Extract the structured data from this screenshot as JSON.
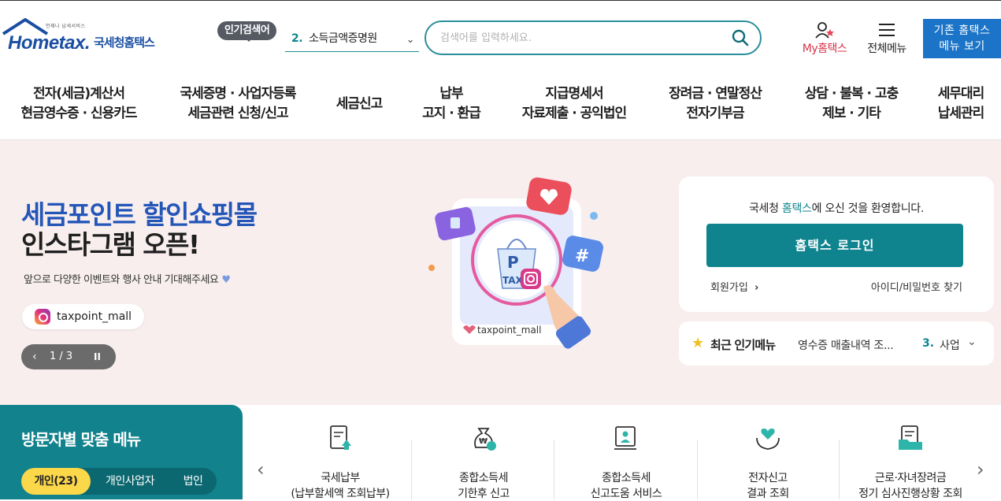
{
  "header": {
    "logo_tiny": "언제나 납세서비스",
    "logo_brand": "Hometax.",
    "logo_ko": "국세청홈택스",
    "popular_badge": "인기검색어",
    "popular_num": "2.",
    "popular_term": "소득금액증명원",
    "search_placeholder": "검색어를 입력하세요.",
    "my_hometax": "My홈택스",
    "all_menu": "전체메뉴",
    "old_hometax_1": "기존 홈택스",
    "old_hometax_2": "메뉴 보기"
  },
  "gnb": [
    {
      "l1": "전자(세금)계산서",
      "l2": "현금영수증 · 신용카드"
    },
    {
      "l1": "국세증명 · 사업자등록",
      "l2": "세금관련 신청/신고"
    },
    {
      "l1": "세금신고",
      "l2": ""
    },
    {
      "l1": "납부",
      "l2": "고지 · 환급"
    },
    {
      "l1": "지급명세서",
      "l2": "자료제출 · 공익법인"
    },
    {
      "l1": "장려금 · 연말정산",
      "l2": "전자기부금"
    },
    {
      "l1": "상담 · 불복 · 고충",
      "l2": "제보 · 기타"
    },
    {
      "l1": "세무대리",
      "l2": "납세관리"
    }
  ],
  "banner": {
    "title1": "세금포인트 할인쇼핑몰",
    "title2": "인스타그램 오픈!",
    "subtitle": "앞으로 다양한 이벤트와 행사 안내 기대해주세요",
    "tag": "taxpoint_mall",
    "pager": "1 / 3",
    "card_tag": "taxpoint_mall",
    "bag_letter": "P",
    "bag_text": "TAX"
  },
  "login": {
    "welcome_pre": "국세청 ",
    "welcome_hl": "홈택스",
    "welcome_post": "에 오신 것을 환영합니다.",
    "login_button": "홈택스 로그인",
    "signup": "회원가입",
    "find": "아이디/비밀번호 찾기"
  },
  "recent": {
    "title": "최근 인기메뉴",
    "item": "영수증 매출내역 조...",
    "num": "3.",
    "category": "사업"
  },
  "visitor": {
    "title": "방문자별 맞춤 메뉴",
    "tabs": [
      "개인(23)",
      "개인사업자",
      "법인"
    ]
  },
  "quick_menu": [
    {
      "l1": "국세납부",
      "l2": "(납부할세액 조회납부)"
    },
    {
      "l1": "종합소득세",
      "l2": "기한후 신고"
    },
    {
      "l1": "종합소득세",
      "l2": "신고도움 서비스"
    },
    {
      "l1": "전자신고",
      "l2": "결과 조회"
    },
    {
      "l1": "근로·자녀장려금",
      "l2": "정기 심사진행상황 조회"
    }
  ],
  "colors": {
    "teal": "#0f848f",
    "brand_blue": "#1a4ea2",
    "banner_bg": "#f8eeee",
    "old_hometax_bg": "#1b74c7",
    "tab_active": "#fbd74a"
  }
}
